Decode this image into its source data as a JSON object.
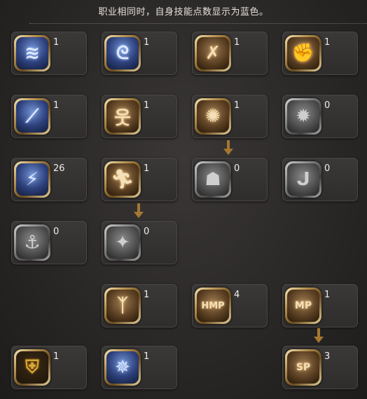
{
  "header": {
    "text": "职业相同时，自身技能点数显示为蓝色。"
  },
  "skills": [
    {
      "id": "r1c1",
      "level": "1",
      "icon": "feather-wing-icon",
      "tone": "blue"
    },
    {
      "id": "r1c2",
      "level": "1",
      "icon": "swirl-icon",
      "tone": "blue"
    },
    {
      "id": "r1c3",
      "level": "1",
      "icon": "flip-kick-icon",
      "tone": "brown"
    },
    {
      "id": "r1c4",
      "level": "1",
      "icon": "fist-icon",
      "tone": "brown"
    },
    {
      "id": "r2c1",
      "level": "1",
      "icon": "slash-icon",
      "tone": "blue"
    },
    {
      "id": "r2c2",
      "level": "1",
      "icon": "figure-icon",
      "tone": "brown"
    },
    {
      "id": "r2c3",
      "level": "1",
      "icon": "punch-icon",
      "tone": "brown"
    },
    {
      "id": "r2c4",
      "level": "0",
      "icon": "sp-burst-icon",
      "tone": "gray"
    },
    {
      "id": "r3c1",
      "level": "26",
      "icon": "strike-icon",
      "tone": "blue"
    },
    {
      "id": "r3c2",
      "level": "1",
      "icon": "run-icon",
      "tone": "brown"
    },
    {
      "id": "r3c3",
      "level": "0",
      "icon": "body-icon",
      "tone": "gray"
    },
    {
      "id": "r3c4",
      "level": "0",
      "icon": "arm-icon",
      "tone": "gray"
    },
    {
      "id": "r4c1",
      "level": "0",
      "icon": "anchor-icon",
      "tone": "gray"
    },
    {
      "id": "r4c2",
      "level": "0",
      "icon": "crash-icon",
      "tone": "gray"
    },
    {
      "id": "r5c2",
      "level": "1",
      "icon": "stance-icon",
      "tone": "brown"
    },
    {
      "id": "r5c3",
      "level": "4",
      "icon": "hp-mp-icon",
      "tone": "brown"
    },
    {
      "id": "r5c4",
      "level": "1",
      "icon": "mp-icon",
      "tone": "brown"
    },
    {
      "id": "r6c1",
      "level": "1",
      "icon": "shield-icon",
      "tone": "shield"
    },
    {
      "id": "r6c2",
      "level": "1",
      "icon": "aura-icon",
      "tone": "blue"
    },
    {
      "id": "r6c4",
      "level": "3",
      "icon": "sp-icon",
      "tone": "brown"
    }
  ]
}
